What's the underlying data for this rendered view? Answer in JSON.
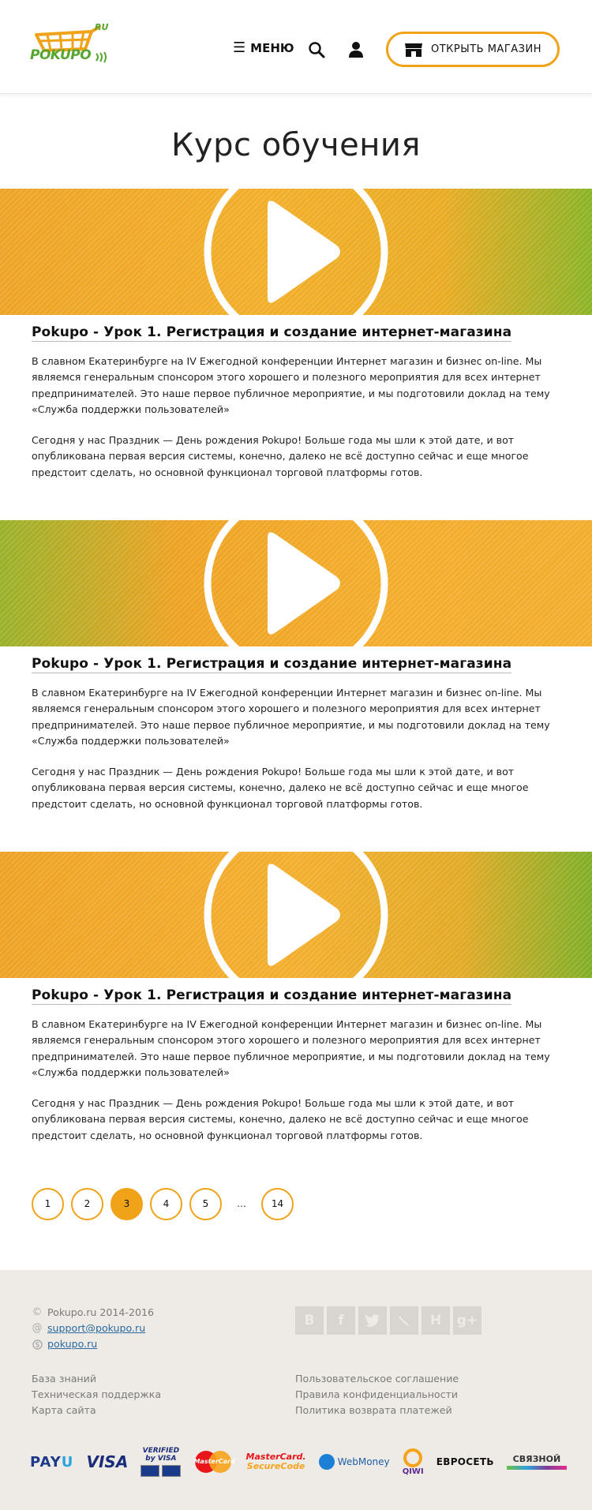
{
  "header": {
    "logo_text": "POKUPO",
    "logo_suffix": "RU",
    "menu_label": "МЕНЮ",
    "open_shop_label": "ОТКРЫТЬ МАГАЗИН"
  },
  "page": {
    "title": "Курс обучения"
  },
  "lessons": [
    {
      "title": "Pokupo - Урок 1. Регистрация и создание интернет-магазина",
      "p1": "В славном Екатеринбурге на IV Ежегодной конференции Интернет магазин и бизнес on-line. Мы являемся генеральным спонсором этого хорошего и полезного мероприятия для всех интернет предпринимателей. Это наше первое публичное мероприятие, и мы подготовили доклад на тему «Служба поддержки пользователей»",
      "p2": "Сегодня у нас Праздник — День рождения Pokupo! Больше года мы шли к этой дате, и вот опубликована первая версия системы, конечно, далеко не всё доступно сейчас и еще многое предстоит сделать, но основной функционал торговой платформы готов."
    },
    {
      "title": "Pokupo - Урок 1. Регистрация и создание интернет-магазина",
      "p1": "В славном Екатеринбурге на IV Ежегодной конференции Интернет магазин и бизнес on-line. Мы являемся генеральным спонсором этого хорошего и полезного мероприятия для всех интернет предпринимателей. Это наше первое публичное мероприятие, и мы подготовили доклад на тему «Служба поддержки пользователей»",
      "p2": "Сегодня у нас Праздник — День рождения Pokupo! Больше года мы шли к этой дате, и вот опубликована первая версия системы, конечно, далеко не всё доступно сейчас и еще многое предстоит сделать, но основной функционал торговой платформы готов."
    },
    {
      "title": "Pokupo - Урок 1. Регистрация и создание интернет-магазина",
      "p1": "В славном Екатеринбурге на IV Ежегодной конференции Интернет магазин и бизнес on-line. Мы являемся генеральным спонсором этого хорошего и полезного мероприятия для всех интернет предпринимателей. Это наше первое публичное мероприятие, и мы подготовили доклад на тему «Служба поддержки пользователей»",
      "p2": "Сегодня у нас Праздник — День рождения Pokupo! Больше года мы шли к этой дате, и вот опубликована первая версия системы, конечно, далеко не всё доступно сейчас и еще многое предстоит сделать, но основной функционал торговой платформы готов."
    }
  ],
  "pagination": {
    "pages": [
      "1",
      "2",
      "3",
      "4",
      "5"
    ],
    "active": "3",
    "ellipsis": "...",
    "last": "14"
  },
  "footer": {
    "copyright": "Pokupo.ru 2014-2016",
    "email": "support@pokupo.ru",
    "skype": "pokupo.ru",
    "links_left": [
      "База знаний",
      "Техническая поддержка",
      "Карта сайта"
    ],
    "links_right": [
      "Пользовательское соглашение",
      "Правила конфиденциальности",
      "Политика возврата платежей"
    ],
    "social": [
      "vk-icon",
      "facebook-icon",
      "twitter-icon",
      "livejournal-icon",
      "habrahabr-icon",
      "google-plus-icon"
    ],
    "payments": {
      "payu": "PAY",
      "payu_u": "U",
      "visa": "VISA",
      "vbv_line1": "VERIFIED",
      "vbv_line2": "by VISA",
      "mastercard": "MasterCard",
      "mc_securecode_1": "MasterCard.",
      "mc_securecode_2": "SecureCode",
      "webmoney": "WebMoney",
      "qiwi": "QIWI",
      "euroset": "ЕВРОСЕТЬ",
      "svyaznoy": "СВЯЗНОЙ"
    }
  },
  "colors": {
    "accent": "#f0a318",
    "logo_green": "#56a52f",
    "logo_orange": "#f0a318",
    "footer_bg": "#eeebe6"
  }
}
